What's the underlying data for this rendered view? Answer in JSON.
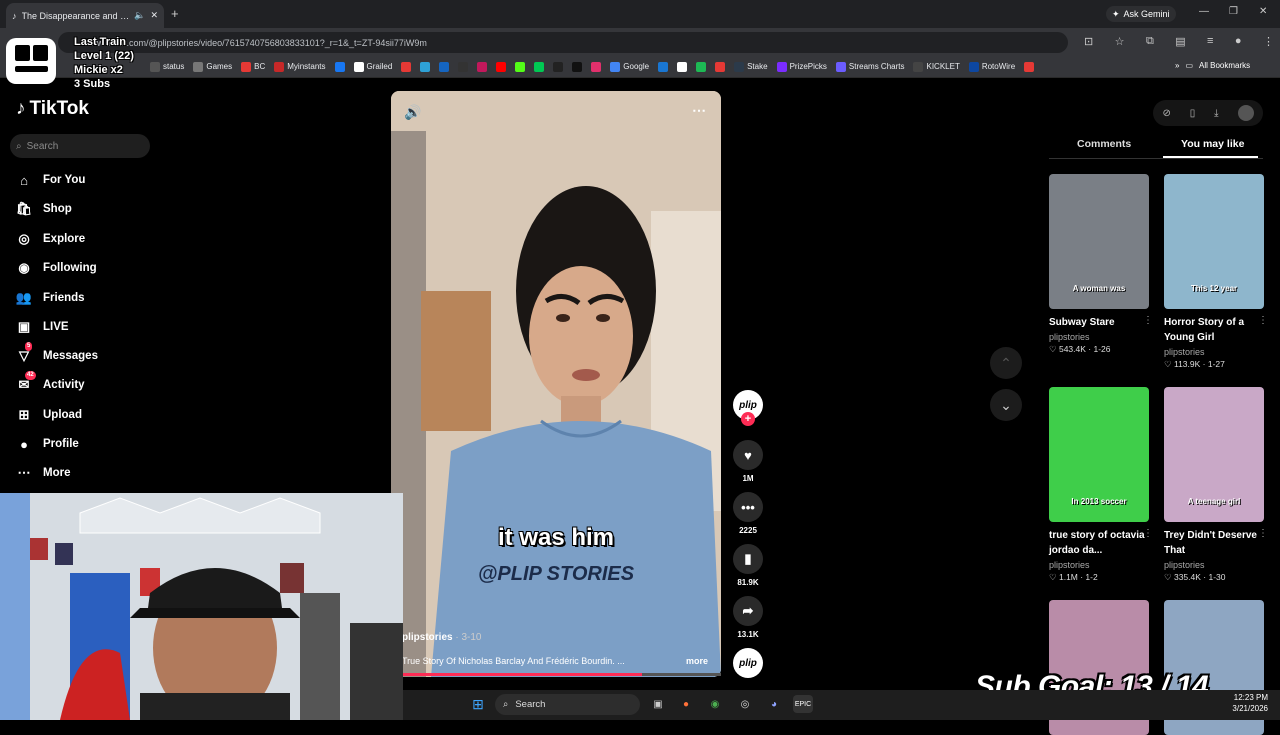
{
  "browser": {
    "tab_title": "The Disappearance and Dra",
    "new_tab": "+",
    "url": "www.tiktok.com/@plipstories/video/7615740756803833101?_r=1&_t=ZT-94sii77iW9m",
    "ask_gemini": "Ask Gemini",
    "bookmarks": [
      {
        "label": "status",
        "color": "#555"
      },
      {
        "label": "Games",
        "color": "#777"
      },
      {
        "label": "BC",
        "color": "#e53935"
      },
      {
        "label": "Myinstants",
        "color": "#c62828"
      },
      {
        "label": "",
        "color": "#1877f2"
      },
      {
        "label": "Grailed",
        "color": "#fff"
      },
      {
        "label": "",
        "color": "#e53935"
      },
      {
        "label": "",
        "color": "#2ea1d6"
      },
      {
        "label": "",
        "color": "#1565c0"
      },
      {
        "label": "",
        "color": "#333"
      },
      {
        "label": "",
        "color": "#c2185b"
      },
      {
        "label": "",
        "color": "#ff0000"
      },
      {
        "label": "",
        "color": "#53fc18"
      },
      {
        "label": "",
        "color": "#00c853"
      },
      {
        "label": "",
        "color": "#222"
      },
      {
        "label": "",
        "color": "#111"
      },
      {
        "label": "",
        "color": "#e1306c"
      },
      {
        "label": "Google",
        "color": "#4285f4"
      },
      {
        "label": "",
        "color": "#1976d2"
      },
      {
        "label": "",
        "color": "#fff"
      },
      {
        "label": "",
        "color": "#1db954"
      },
      {
        "label": "",
        "color": "#e53935"
      },
      {
        "label": "Stake",
        "color": "#2b3a4a"
      },
      {
        "label": "PrizePicks",
        "color": "#7b2cff"
      },
      {
        "label": "Streams Charts",
        "color": "#6b5cff"
      },
      {
        "label": "KICKLET",
        "color": "#444"
      },
      {
        "label": "RotoWire",
        "color": "#0d47a1"
      },
      {
        "label": "",
        "color": "#e53935"
      }
    ],
    "all_bookmarks": "All Bookmarks"
  },
  "overlay": {
    "line1": "Last Train",
    "line2": "Level 1  (22)",
    "line3": "Mickie x2",
    "line4": "3 Subs"
  },
  "sidebar": {
    "logo": "TikTok",
    "search_placeholder": "Search",
    "items": [
      {
        "label": "For You",
        "icon": "⌂",
        "badge": ""
      },
      {
        "label": "Shop",
        "icon": "🛍",
        "badge": ""
      },
      {
        "label": "Explore",
        "icon": "◎",
        "badge": ""
      },
      {
        "label": "Following",
        "icon": "◉",
        "badge": ""
      },
      {
        "label": "Friends",
        "icon": "👥",
        "badge": ""
      },
      {
        "label": "LIVE",
        "icon": "▣",
        "badge": ""
      },
      {
        "label": "Messages",
        "icon": "▽",
        "badge": "5"
      },
      {
        "label": "Activity",
        "icon": "✉",
        "badge": "42"
      },
      {
        "label": "Upload",
        "icon": "⊞",
        "badge": ""
      },
      {
        "label": "Profile",
        "icon": "●",
        "badge": ""
      },
      {
        "label": "More",
        "icon": "⋯",
        "badge": ""
      }
    ]
  },
  "video": {
    "caption": "it was him",
    "shirt_text": "@PLIP STORIES",
    "author": "plipstories",
    "date": "· 3-10",
    "description": "True Story Of Nicholas Barclay And Frédéric Bourdin. ...",
    "more": "more",
    "progress": 0.75
  },
  "actions": {
    "avatar_text": "plip",
    "likes": "1M",
    "comments": "2225",
    "saves": "81.9K",
    "shares": "13.1K"
  },
  "right_panel": {
    "tab_comments": "Comments",
    "tab_you_may_like": "You may like",
    "cards": [
      {
        "title": "Subway Stare",
        "author": "plipstories",
        "stats": "♡ 543.4K · 1-26",
        "thumb_text": "A woman was",
        "bg": "#7a7f86"
      },
      {
        "title": "Horror Story of a Young Girl",
        "author": "plipstories",
        "stats": "♡ 113.9K · 1-27",
        "thumb_text": "This 12 year",
        "bg": "#8eb6cc"
      },
      {
        "title": "true story of octavia jordao da...",
        "author": "plipstories",
        "stats": "♡ 1.1M · 1-2",
        "thumb_text": "In 2013 soccer",
        "bg": "#3fce4a"
      },
      {
        "title": "Trey Didn't Deserve That",
        "author": "plipstories",
        "stats": "♡ 335.4K · 1-30",
        "thumb_text": "A teenage girl",
        "bg": "#c9a8c7"
      },
      {
        "title": "",
        "author": "",
        "stats": "",
        "thumb_text": "",
        "bg": "#b98ca8"
      },
      {
        "title": "",
        "author": "",
        "stats": "",
        "thumb_text": "",
        "bg": "#8ea6c2"
      }
    ]
  },
  "subgoal": "Sub Goal:  13 / 14",
  "taskbar": {
    "search": "Search",
    "time": "12:23 PM",
    "date": "3/21/2026"
  }
}
